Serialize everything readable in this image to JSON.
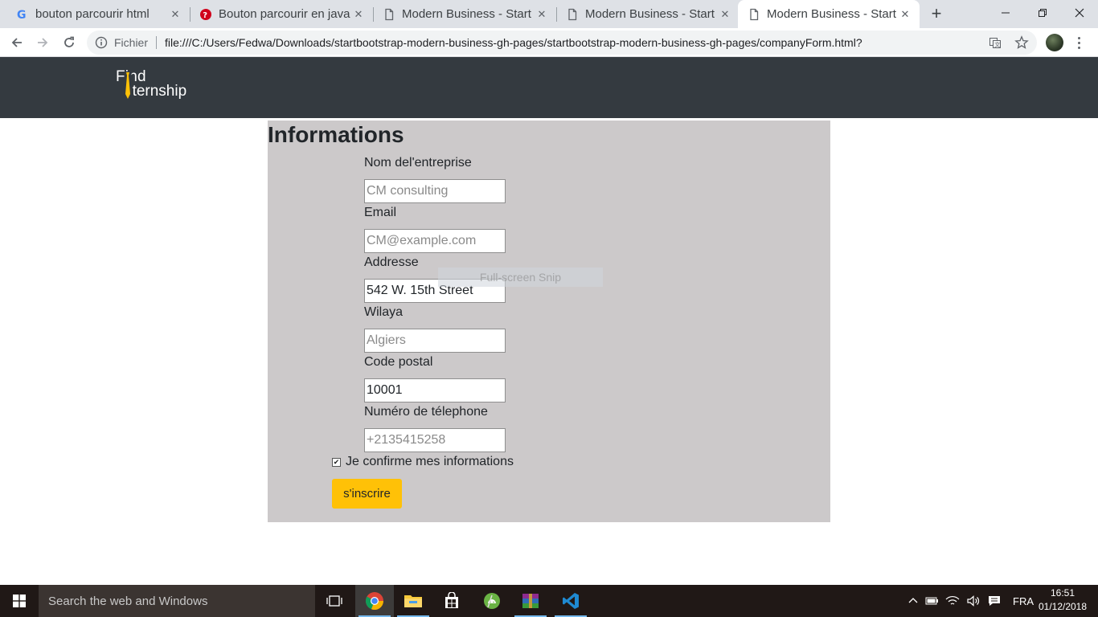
{
  "browser": {
    "tabs": [
      {
        "title": "bouton parcourir html",
        "favicon": "google-icon",
        "active": false
      },
      {
        "title": "Bouton parcourir en java",
        "favicon": "quora-icon",
        "active": false
      },
      {
        "title": "Modern Business - Start",
        "favicon": "page-icon",
        "active": false
      },
      {
        "title": "Modern Business - Start",
        "favicon": "page-icon",
        "active": false
      },
      {
        "title": "Modern Business - Start",
        "favicon": "page-icon",
        "active": true
      }
    ],
    "new_tab": "+",
    "address": {
      "scheme_label": "Fichier",
      "url": "file:///C:/Users/Fedwa/Downloads/startbootstrap-modern-business-gh-pages/startbootstrap-modern-business-gh-pages/companyForm.html?"
    }
  },
  "site": {
    "logo": {
      "line1": "Find",
      "line2": "nternship"
    }
  },
  "form": {
    "title": "Informations",
    "fields": [
      {
        "label": "Nom del'entreprise",
        "placeholder": "CM consulting",
        "value": ""
      },
      {
        "label": "Email",
        "placeholder": "CM@example.com",
        "value": ""
      },
      {
        "label": "Addresse",
        "placeholder": "",
        "value": "542 W. 15th Street"
      },
      {
        "label": "Wilaya",
        "placeholder": "Algiers",
        "value": ""
      },
      {
        "label": "Code postal",
        "placeholder": "",
        "value": "10001"
      },
      {
        "label": "Numéro de télephone",
        "placeholder": "+2135415258",
        "value": ""
      }
    ],
    "confirm_label": "Je confirme mes informations",
    "confirm_checked": true,
    "submit_label": "s'inscrire"
  },
  "overlay": {
    "text": "Full-screen Snip"
  },
  "taskbar": {
    "search_placeholder": "Search the web and Windows",
    "language": "FRA",
    "time": "16:51",
    "date": "01/12/2018"
  },
  "colors": {
    "navbar_bg": "#343a40",
    "panel_bg": "#ccc9ca",
    "button_bg": "#ffc107",
    "logo_accent": "#ffc107"
  }
}
